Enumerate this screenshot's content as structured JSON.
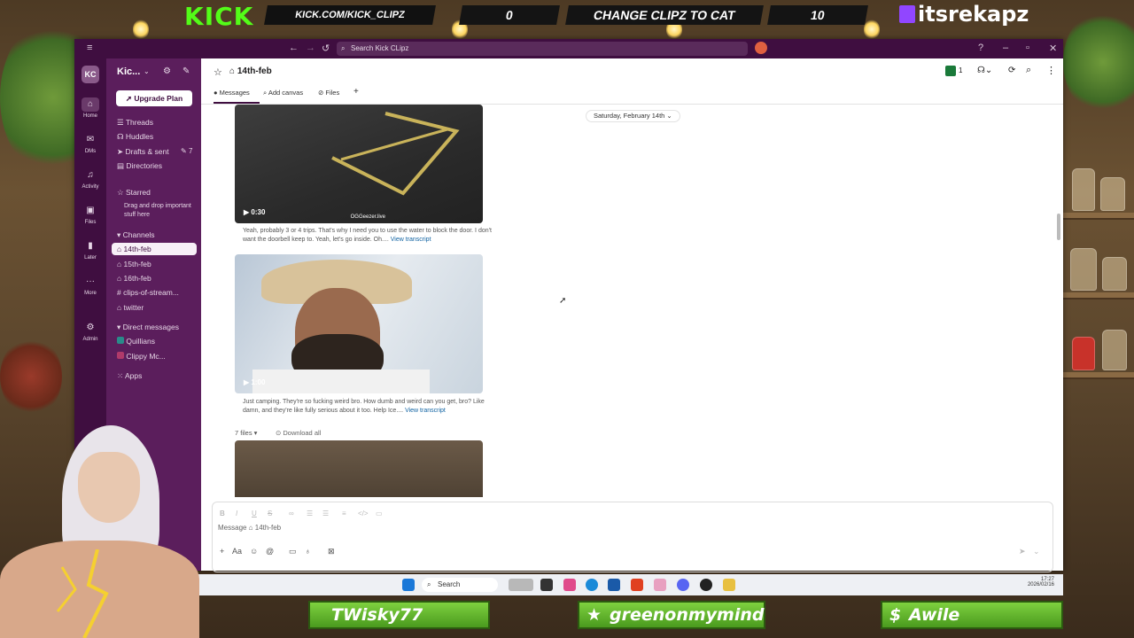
{
  "overlay": {
    "kick_logo": "KICK",
    "kick_url": "KICK.COM/KICK_CLIPZ",
    "score_left": "0",
    "change_label": "CHANGE CLIPZ TO CAT",
    "score_right": "10",
    "twitch_name": "itsrekapz",
    "banners": [
      "TWisky77",
      "greenonmymind",
      "Awile"
    ],
    "accent_green": "#53fc18",
    "twitch_purple": "#9146ff"
  },
  "titlebar": {
    "search_placeholder": "Search Kick CLipz"
  },
  "rail": {
    "workspace_initials": "KC",
    "items": [
      "Home",
      "DMs",
      "Activity",
      "Files",
      "Later",
      "More",
      "Admin"
    ]
  },
  "sidebar": {
    "workspace_name": "Kic...",
    "upgrade_label": "Upgrade Plan",
    "nav": [
      "Threads",
      "Huddles",
      "Drafts & sent",
      "Directories"
    ],
    "drafts_count": "7",
    "starred_header": "Starred",
    "starred_hint": "Drag and drop important stuff here",
    "channels_header": "Channels",
    "channels": [
      "14th-feb",
      "15th-feb",
      "16th-feb",
      "clips-of-stream...",
      "twitter"
    ],
    "dm_header": "Direct messages",
    "dms": [
      "Quillians",
      "Clippy Mc..."
    ],
    "apps_label": "Apps",
    "brand_color": "#3f0e40"
  },
  "channel": {
    "name": "14th-feb",
    "tabs": [
      "Messages",
      "Add canvas",
      "Files"
    ],
    "member_count": "1",
    "date_divider": "Saturday, February 14th",
    "videos": [
      {
        "duration": "0:30",
        "watermark": "OGGeezer.live"
      },
      {
        "duration": "1:00"
      }
    ],
    "captions": [
      {
        "text": "Yeah, probably 3 or 4 trips. That's why I need you to use the water to block the door. I don't want the doorbell keep to. Yeah, let's go inside. Oh....",
        "link": "View transcript"
      },
      {
        "text": "Just camping. They're so fucking weird bro. How dumb and weird can you get, bro? Like damn, and they're like fully serious about it too. Help Ice....",
        "link": "View transcript"
      }
    ],
    "files_count": "7 files",
    "download_all": "Download all"
  },
  "composer": {
    "placeholder": "Message ⌂ 14th-feb"
  },
  "taskbar": {
    "search_label": "Search",
    "time": "17:27",
    "date": "2026/02/16"
  }
}
